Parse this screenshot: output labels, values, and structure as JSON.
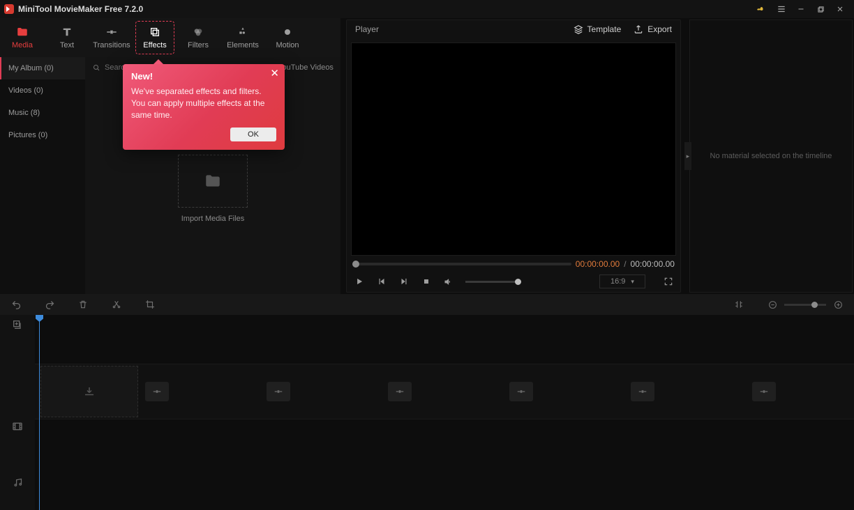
{
  "title": "MiniTool MovieMaker Free 7.2.0",
  "tabs": {
    "media": "Media",
    "text": "Text",
    "transitions": "Transitions",
    "effects": "Effects",
    "filters": "Filters",
    "elements": "Elements",
    "motion": "Motion"
  },
  "sidebar": {
    "items": [
      {
        "label": "My Album (0)"
      },
      {
        "label": "Videos (0)"
      },
      {
        "label": "Music (8)"
      },
      {
        "label": "Pictures (0)"
      }
    ]
  },
  "search": {
    "placeholder": "Search",
    "right_link": "YouTube Videos"
  },
  "import": {
    "label": "Import Media Files"
  },
  "player": {
    "title": "Player",
    "template": "Template",
    "export": "Export",
    "cur_time": "00:00:00.00",
    "sep": "/",
    "total_time": "00:00:00.00",
    "ratio": "16:9"
  },
  "props": {
    "empty": "No material selected on the timeline"
  },
  "popup": {
    "title": "New!",
    "body": "We've separated effects and filters. You can apply multiple effects at the same time.",
    "ok": "OK"
  }
}
